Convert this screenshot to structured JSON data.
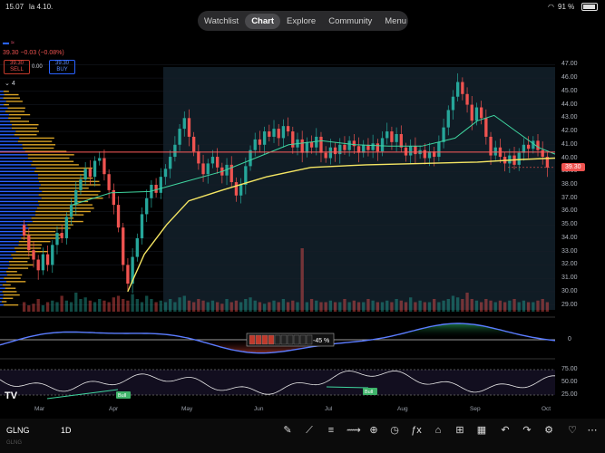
{
  "status_bar": {
    "time": "15.07",
    "date": "la 4.10.",
    "battery": "91 %"
  },
  "nav": {
    "items": [
      "Watchlist",
      "Chart",
      "Explore",
      "Community",
      "Menu"
    ],
    "active": "Chart"
  },
  "legend": {
    "change": "39.30 −0.03 (−0.08%)",
    "sell_price": "39.30",
    "sell_label": "SELL",
    "spread": "0.00",
    "buy_price": "39.30",
    "buy_label": "BUY",
    "indicator_count": "4"
  },
  "price_axis": {
    "ticks": [
      "47.00",
      "46.00",
      "45.00",
      "44.00",
      "43.00",
      "42.00",
      "41.00",
      "40.00",
      "39.00",
      "38.00",
      "37.00",
      "36.00",
      "35.00",
      "34.00",
      "33.00",
      "32.00",
      "31.00",
      "30.00",
      "29.00"
    ],
    "last_price": "39.30",
    "level_line": "40.45"
  },
  "oscillator": {
    "zero_label": "0",
    "gauge_value": "-45 %"
  },
  "rsi": {
    "ticks": [
      "75.00",
      "50.00",
      "25.00"
    ],
    "bull_labels": [
      "Bull",
      "Bull"
    ]
  },
  "time_axis": [
    "Mar",
    "Apr",
    "May",
    "Jun",
    "Jul",
    "Aug",
    "Sep",
    "Oct"
  ],
  "toolbar": {
    "symbol": "GLNG",
    "symbol_sub": "GLNG",
    "timeframe": "1D"
  },
  "colors": {
    "up": "#26a69a",
    "down": "#ef5350",
    "vwap": "#f5e663",
    "volume_profile_blue": "#2962ff",
    "volume_profile_orange": "#f0b429",
    "level_line": "#ff5c5c"
  },
  "chart_data": {
    "type": "candlestick",
    "ylim": [
      28.5,
      47.5
    ],
    "candles": [
      {
        "o": 35.0,
        "c": 34.2
      },
      {
        "o": 34.2,
        "c": 33.1
      },
      {
        "o": 33.1,
        "c": 32.4
      },
      {
        "o": 32.4,
        "c": 31.6
      },
      {
        "o": 31.6,
        "c": 32.8
      },
      {
        "o": 32.8,
        "c": 32.0
      },
      {
        "o": 32.0,
        "c": 33.5
      },
      {
        "o": 33.5,
        "c": 34.4
      },
      {
        "o": 34.4,
        "c": 34.0
      },
      {
        "o": 34.0,
        "c": 35.6
      },
      {
        "o": 35.6,
        "c": 36.5
      },
      {
        "o": 36.5,
        "c": 37.6
      },
      {
        "o": 37.6,
        "c": 38.4
      },
      {
        "o": 38.4,
        "c": 39.2
      },
      {
        "o": 39.2,
        "c": 38.6
      },
      {
        "o": 38.6,
        "c": 39.8
      },
      {
        "o": 39.8,
        "c": 40.0
      },
      {
        "o": 40.0,
        "c": 38.8
      },
      {
        "o": 38.8,
        "c": 37.6
      },
      {
        "o": 37.6,
        "c": 36.5
      },
      {
        "o": 36.5,
        "c": 34.8
      },
      {
        "o": 34.8,
        "c": 32.0
      },
      {
        "o": 32.0,
        "c": 30.6
      },
      {
        "o": 30.6,
        "c": 32.6
      },
      {
        "o": 32.6,
        "c": 34.0
      },
      {
        "o": 34.0,
        "c": 35.8
      },
      {
        "o": 35.8,
        "c": 37.0
      },
      {
        "o": 37.0,
        "c": 38.0
      },
      {
        "o": 38.0,
        "c": 37.4
      },
      {
        "o": 37.4,
        "c": 38.6
      },
      {
        "o": 38.6,
        "c": 39.2
      },
      {
        "o": 39.2,
        "c": 40.1
      },
      {
        "o": 40.1,
        "c": 41.0
      },
      {
        "o": 41.0,
        "c": 42.2
      },
      {
        "o": 42.2,
        "c": 43.0
      },
      {
        "o": 43.0,
        "c": 41.6
      },
      {
        "o": 41.6,
        "c": 40.5
      },
      {
        "o": 40.5,
        "c": 39.6
      },
      {
        "o": 39.6,
        "c": 38.8
      },
      {
        "o": 38.8,
        "c": 39.6
      },
      {
        "o": 39.6,
        "c": 40.1
      },
      {
        "o": 40.1,
        "c": 39.3
      },
      {
        "o": 39.3,
        "c": 38.7
      },
      {
        "o": 38.7,
        "c": 39.5
      },
      {
        "o": 39.5,
        "c": 38.2
      },
      {
        "o": 38.2,
        "c": 37.2
      },
      {
        "o": 37.2,
        "c": 38.0
      },
      {
        "o": 38.0,
        "c": 39.4
      },
      {
        "o": 39.4,
        "c": 40.6
      },
      {
        "o": 40.6,
        "c": 41.4
      },
      {
        "o": 41.4,
        "c": 41.0
      },
      {
        "o": 41.0,
        "c": 42.0
      },
      {
        "o": 42.0,
        "c": 41.6
      },
      {
        "o": 41.6,
        "c": 42.2
      },
      {
        "o": 42.2,
        "c": 41.5
      },
      {
        "o": 41.5,
        "c": 42.4
      },
      {
        "o": 42.4,
        "c": 42.0
      },
      {
        "o": 42.0,
        "c": 40.8
      },
      {
        "o": 40.8,
        "c": 41.4
      },
      {
        "o": 41.4,
        "c": 40.4
      },
      {
        "o": 40.4,
        "c": 41.2
      },
      {
        "o": 41.2,
        "c": 40.8
      },
      {
        "o": 40.8,
        "c": 41.6
      },
      {
        "o": 41.6,
        "c": 40.4
      },
      {
        "o": 40.4,
        "c": 40.0
      },
      {
        "o": 40.0,
        "c": 40.8
      },
      {
        "o": 40.8,
        "c": 40.3
      },
      {
        "o": 40.3,
        "c": 41.0
      },
      {
        "o": 41.0,
        "c": 40.6
      },
      {
        "o": 40.6,
        "c": 41.3
      },
      {
        "o": 41.3,
        "c": 40.9
      },
      {
        "o": 40.9,
        "c": 40.4
      },
      {
        "o": 40.4,
        "c": 41.0
      },
      {
        "o": 41.0,
        "c": 40.6
      },
      {
        "o": 40.6,
        "c": 41.1
      },
      {
        "o": 41.1,
        "c": 40.5
      },
      {
        "o": 40.5,
        "c": 41.5
      },
      {
        "o": 41.5,
        "c": 42.0
      },
      {
        "o": 42.0,
        "c": 41.2
      },
      {
        "o": 41.2,
        "c": 41.8
      },
      {
        "o": 41.8,
        "c": 40.8
      },
      {
        "o": 40.8,
        "c": 40.2
      },
      {
        "o": 40.2,
        "c": 40.9
      },
      {
        "o": 40.9,
        "c": 40.3
      },
      {
        "o": 40.3,
        "c": 40.6
      },
      {
        "o": 40.6,
        "c": 40.0
      },
      {
        "o": 40.0,
        "c": 40.5
      },
      {
        "o": 40.5,
        "c": 40.1
      },
      {
        "o": 40.1,
        "c": 41.2
      },
      {
        "o": 41.2,
        "c": 42.3
      },
      {
        "o": 42.3,
        "c": 43.6
      },
      {
        "o": 43.6,
        "c": 44.6
      },
      {
        "o": 44.6,
        "c": 45.7
      },
      {
        "o": 45.7,
        "c": 44.8
      },
      {
        "o": 44.8,
        "c": 44.0
      },
      {
        "o": 44.0,
        "c": 42.8
      },
      {
        "o": 42.8,
        "c": 43.8
      },
      {
        "o": 43.8,
        "c": 43.0
      },
      {
        "o": 43.0,
        "c": 41.6
      },
      {
        "o": 41.6,
        "c": 40.2
      },
      {
        "o": 40.2,
        "c": 40.8
      },
      {
        "o": 40.8,
        "c": 40.1
      },
      {
        "o": 40.1,
        "c": 39.6
      },
      {
        "o": 39.6,
        "c": 40.2
      },
      {
        "o": 40.2,
        "c": 39.5
      },
      {
        "o": 39.5,
        "c": 40.4
      },
      {
        "o": 40.4,
        "c": 41.0
      },
      {
        "o": 41.0,
        "c": 40.7
      },
      {
        "o": 40.7,
        "c": 41.3
      },
      {
        "o": 41.3,
        "c": 40.6
      },
      {
        "o": 40.6,
        "c": 40.1
      },
      {
        "o": 40.1,
        "c": 39.3
      }
    ],
    "vwap": [
      [
        0.23,
        30.0
      ],
      [
        0.26,
        32.8
      ],
      [
        0.3,
        35.0
      ],
      [
        0.34,
        36.8
      ],
      [
        0.4,
        37.6
      ],
      [
        0.48,
        38.6
      ],
      [
        0.56,
        39.3
      ],
      [
        0.66,
        39.5
      ],
      [
        0.76,
        39.6
      ],
      [
        0.86,
        39.7
      ],
      [
        0.94,
        39.9
      ],
      [
        1.0,
        40.0
      ]
    ],
    "ma": [
      [
        0.13,
        36.5
      ],
      [
        0.2,
        37.4
      ],
      [
        0.27,
        37.5
      ],
      [
        0.33,
        38.2
      ],
      [
        0.4,
        39.0
      ],
      [
        0.46,
        40.0
      ],
      [
        0.52,
        41.0
      ],
      [
        0.58,
        41.3
      ],
      [
        0.64,
        41.0
      ],
      [
        0.7,
        40.9
      ],
      [
        0.76,
        40.9
      ],
      [
        0.82,
        41.5
      ],
      [
        0.86,
        42.8
      ],
      [
        0.89,
        43.2
      ],
      [
        0.93,
        42.0
      ],
      [
        0.97,
        40.8
      ],
      [
        1.0,
        40.3
      ]
    ],
    "volume": [
      0.3,
      0.2,
      0.25,
      0.4,
      0.2,
      0.3,
      0.35,
      0.3,
      0.5,
      0.35,
      0.3,
      0.6,
      0.4,
      0.45,
      0.35,
      0.3,
      0.4,
      0.35,
      0.3,
      0.45,
      0.5,
      0.4,
      0.35,
      0.55,
      0.4,
      0.3,
      0.5,
      0.4,
      0.3,
      0.35,
      0.3,
      0.4,
      0.3,
      0.45,
      0.5,
      0.35,
      0.3,
      0.4,
      0.35,
      0.3,
      0.35,
      0.3,
      0.25,
      0.4,
      0.3,
      0.35,
      0.3,
      0.4,
      0.45,
      0.35,
      0.3,
      0.25,
      0.3,
      0.35,
      0.3,
      0.4,
      0.3,
      0.35,
      0.3,
      1.0,
      0.3,
      0.4,
      0.35,
      0.3,
      0.3,
      0.35,
      0.3,
      0.3,
      0.4,
      0.3,
      0.35,
      0.3,
      0.3,
      0.4,
      0.35,
      0.3,
      0.3,
      0.35,
      0.3,
      0.4,
      0.35,
      0.3,
      0.45,
      0.3,
      0.35,
      0.3,
      0.3,
      0.4,
      0.3,
      0.35,
      0.4,
      0.5,
      0.45,
      0.4,
      0.6,
      0.4,
      0.35,
      0.3,
      0.4,
      0.35,
      0.3,
      0.35,
      0.3,
      0.35,
      0.4,
      0.3,
      0.35,
      0.3,
      0.3,
      0.35,
      0.4,
      0.3
    ]
  }
}
